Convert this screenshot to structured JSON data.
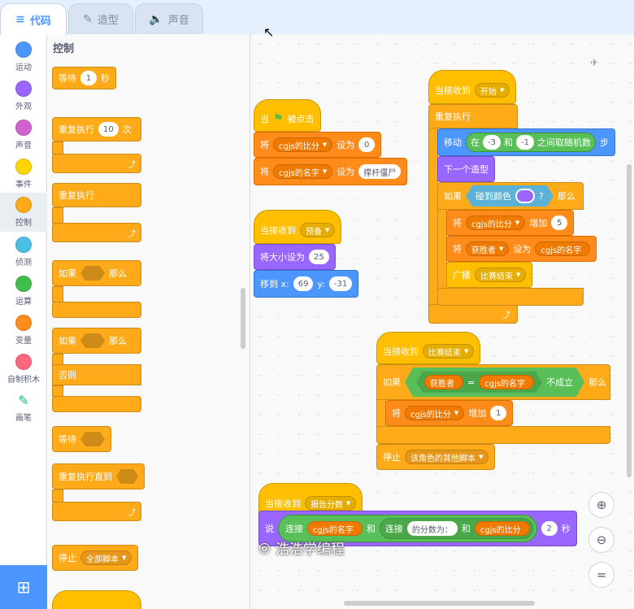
{
  "tabs": [
    {
      "label": "代码",
      "icon": "code-icon"
    },
    {
      "label": "造型",
      "icon": "brush-icon"
    },
    {
      "label": "声音",
      "icon": "speaker-icon"
    }
  ],
  "categories": [
    {
      "label": "运动",
      "color": "#4c97ff"
    },
    {
      "label": "外观",
      "color": "#9966ff"
    },
    {
      "label": "声音",
      "color": "#cf63cf"
    },
    {
      "label": "事件",
      "color": "#ffd500"
    },
    {
      "label": "控制",
      "color": "#ffab19"
    },
    {
      "label": "侦测",
      "color": "#4cbfe6"
    },
    {
      "label": "运算",
      "color": "#40bf4a"
    },
    {
      "label": "变量",
      "color": "#ff8c1a"
    },
    {
      "label": "自制积木",
      "color": "#ff6680"
    },
    {
      "label": "画笔",
      "color": "#0fbd8c"
    }
  ],
  "palette": {
    "heading": "控制",
    "wait": {
      "label": "等待",
      "value": "1",
      "unit": "秒"
    },
    "repeat": {
      "label": "重复执行",
      "value": "10",
      "unit": "次"
    },
    "forever": {
      "label": "重复执行"
    },
    "if_then": {
      "if": "如果",
      "then": "那么"
    },
    "if_else": {
      "if": "如果",
      "then": "那么",
      "else": "否则"
    },
    "wait_until": {
      "label": "等待"
    },
    "repeat_until": {
      "label": "重复执行直到"
    },
    "stop": {
      "label": "停止",
      "option": "全部脚本"
    }
  },
  "scripts": {
    "flag": {
      "hat_when": "当",
      "hat_clicked": "被点击",
      "set1": {
        "label": "将",
        "var": "cgjs的比分",
        "to": "设为",
        "value": "0"
      },
      "set2": {
        "label": "将",
        "var": "cgjs的名字",
        "to": "设为",
        "value": "撑杆僵尸"
      }
    },
    "ready": {
      "hat": "当接收到",
      "msg": "预备",
      "size": {
        "label": "将大小设为",
        "value": "25"
      },
      "goto": {
        "label": "移到 x:",
        "x": "69",
        "ylabel": "y:",
        "y": "-31"
      }
    },
    "start": {
      "hat": "当接收到",
      "msg": "开始",
      "forever": "重复执行",
      "move": {
        "label": "移动",
        "in": "在",
        "a": "-3",
        "and": "和",
        "b": "-1",
        "rand": "之间取随机数",
        "steps": "步"
      },
      "next": "下一个造型",
      "if": "如果",
      "touch": "碰到颜色",
      "q": "?",
      "then": "那么",
      "inc": {
        "label": "将",
        "var": "cgjs的比分",
        "op": "增加",
        "value": "5"
      },
      "setw": {
        "label": "将",
        "var": "获胜者",
        "op": "设为",
        "value": "cgjs的名字"
      },
      "bc": {
        "label": "广播",
        "msg": "比赛结束"
      }
    },
    "end": {
      "hat": "当接收到",
      "msg": "比赛结束",
      "if": "如果",
      "winner": "获胜者",
      "eq": "=",
      "name": "cgjs的名字",
      "not": "不成立",
      "then": "那么",
      "inc": {
        "label": "将",
        "var": "cgjs的比分",
        "op": "增加",
        "value": "1"
      },
      "stop": {
        "label": "停止",
        "option": "该角色的其他脚本"
      }
    },
    "report": {
      "hat": "当接收到",
      "msg": "报告分数",
      "say": "说",
      "join": "连接",
      "name": "cgjs的名字",
      "and": "和",
      "join2": "连接",
      "text": "的分数为：",
      "and2": "和",
      "score": "cgjs的比分",
      "secs": "2",
      "unit": "秒"
    }
  },
  "watermark": "浩浩学编程"
}
